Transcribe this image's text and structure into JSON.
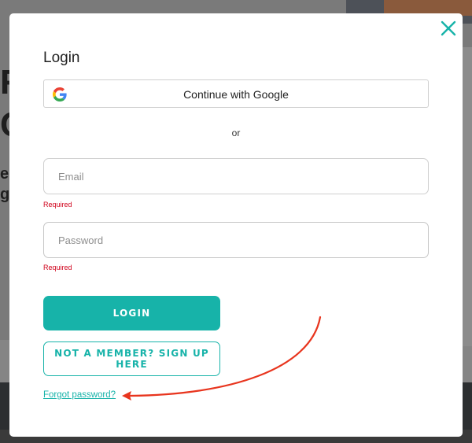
{
  "modal": {
    "title": "Login",
    "google_button_label": "Continue with Google",
    "divider_text": "or",
    "email": {
      "placeholder": "Email",
      "value": "",
      "error": "Required"
    },
    "password": {
      "placeholder": "Password",
      "value": "",
      "error": "Required"
    },
    "login_button_label": "LOGIN",
    "signup_button_label": "NOT A MEMBER? SIGN UP HERE",
    "forgot_link_label": "Forgot password?",
    "close_icon": "close-icon"
  },
  "colors": {
    "accent": "#17b3a9",
    "error": "#d0021b",
    "annotation_arrow": "#e8351e"
  }
}
